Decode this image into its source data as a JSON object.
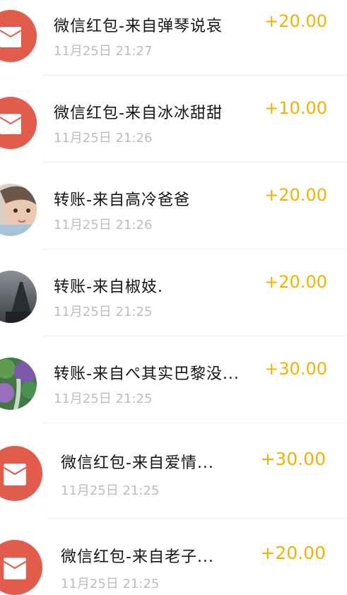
{
  "colors": {
    "amount": "#f2b300",
    "envelope": "#e25c4c",
    "title": "#151515",
    "time": "#bdbdbd"
  },
  "records": [
    {
      "title": "微信红包-来自弹琴说哀",
      "time": "11月25日 21:27",
      "amount": "+20.00",
      "icon": "red-envelope-icon"
    },
    {
      "title": "微信红包-来自冰冰甜甜",
      "time": "11月25日 21:26",
      "amount": "+10.00",
      "icon": "red-envelope-icon"
    },
    {
      "title": "转账-来自高冷爸爸",
      "time": "11月25日 21:26",
      "amount": "+20.00",
      "icon": "child-avatar"
    },
    {
      "title": "转账-来自椒妓.",
      "time": "11月25日 21:25",
      "amount": "+20.00",
      "icon": "tower-avatar"
    },
    {
      "title": "转账-来自ぺ其实巴黎没...",
      "time": "11月25日 21:25",
      "amount": "+30.00",
      "icon": "garden-avatar"
    },
    {
      "title": "微信红包-来自爱情...",
      "time": "11月25日 21:25",
      "amount": "+30.00",
      "icon": "red-envelope-icon"
    },
    {
      "title": "微信红包-来自老子...",
      "time": "11月25日 21:25",
      "amount": "+20.00",
      "icon": "red-envelope-icon"
    }
  ]
}
